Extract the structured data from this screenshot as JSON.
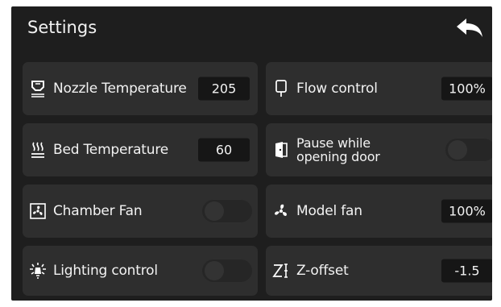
{
  "header": {
    "title": "Settings",
    "back_icon": "back-arrow-icon"
  },
  "left_column": [
    {
      "label": "Nozzle Temperature",
      "icon": "nozzle-icon",
      "control": "value",
      "value": "205"
    },
    {
      "label": "Bed Temperature",
      "icon": "heatbed-icon",
      "control": "value",
      "value": "60"
    },
    {
      "label": "Chamber Fan",
      "icon": "fan-icon",
      "control": "toggle",
      "enabled": false
    },
    {
      "label": "Lighting control",
      "icon": "light-icon",
      "control": "toggle",
      "enabled": false
    }
  ],
  "right_column": [
    {
      "label": "Flow control",
      "icon": "flow-icon",
      "control": "value",
      "value": "100%"
    },
    {
      "label": "Pause while opening door",
      "icon": "door-icon",
      "control": "toggle",
      "enabled": false
    },
    {
      "label": "Model fan",
      "icon": "model-fan-icon",
      "control": "value",
      "value": "100%"
    },
    {
      "label": "Z-offset",
      "icon": "z-offset-icon",
      "control": "value",
      "value": "-1.5"
    }
  ],
  "colors": {
    "screen_bg": "#1e1e1e",
    "card_bg": "#2e2e2e",
    "value_bg": "#161616",
    "text": "#f2f2f2"
  }
}
